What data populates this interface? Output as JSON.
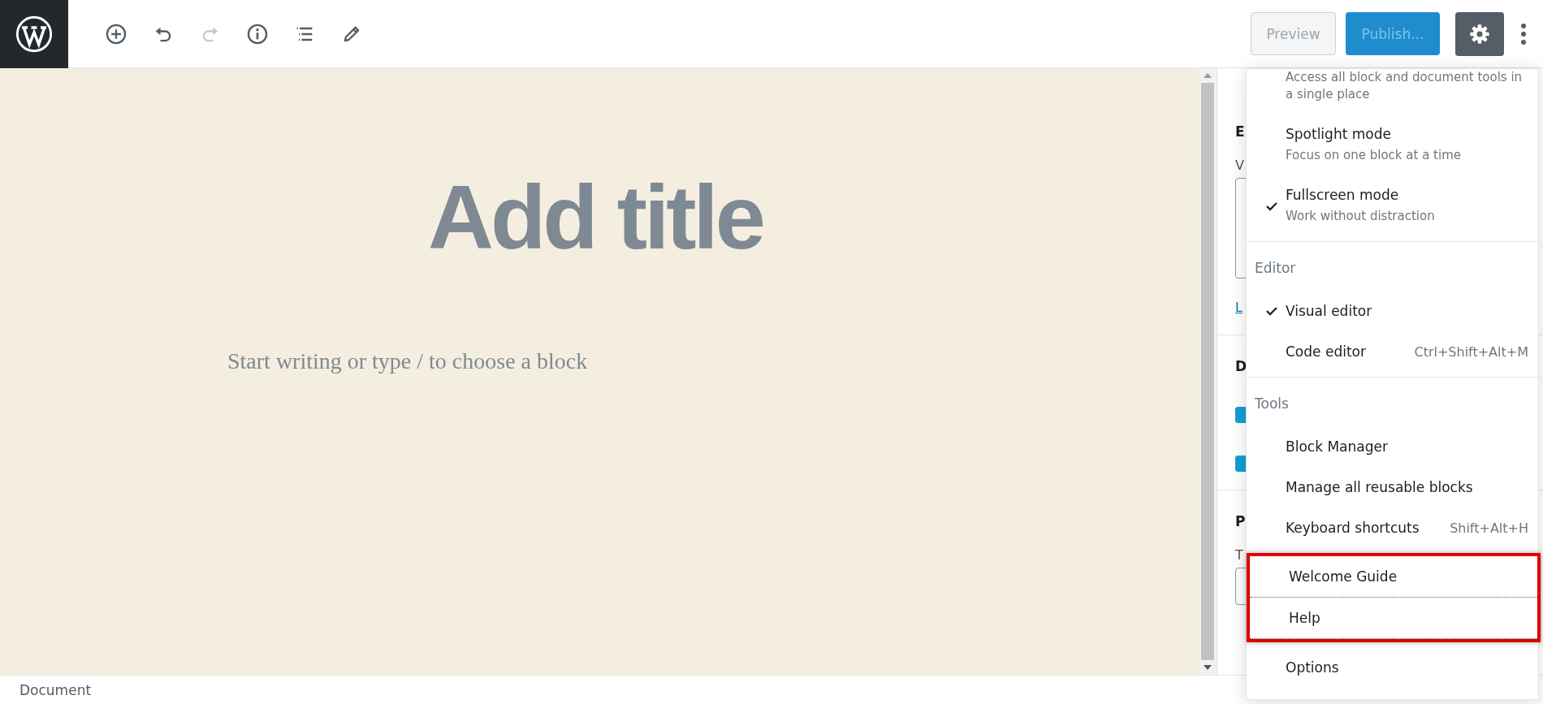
{
  "toolbar": {
    "tools": [
      {
        "kind": "add",
        "disabled": false
      },
      {
        "kind": "undo",
        "disabled": false
      },
      {
        "kind": "redo",
        "disabled": true
      },
      {
        "kind": "info",
        "disabled": false
      },
      {
        "kind": "outline",
        "disabled": false
      },
      {
        "kind": "edit",
        "disabled": false
      }
    ],
    "preview": {
      "label": "Preview"
    },
    "publish": {
      "label": "Publish...",
      "disabled": true
    },
    "settings": {
      "pressed": true
    }
  },
  "editor": {
    "title_placeholder": "Add title",
    "body_placeholder": "Start writing or type / to choose a block"
  },
  "sidebar": {
    "items": [
      {
        "kind": "heading",
        "text": "E"
      },
      {
        "kind": "label",
        "text": "V"
      },
      {
        "kind": "textarea"
      },
      {
        "kind": "link",
        "text": "L"
      },
      {
        "kind": "divider"
      },
      {
        "kind": "heading",
        "text": "D"
      },
      {
        "kind": "checkbox",
        "checked": true
      },
      {
        "kind": "checkbox",
        "checked": true
      },
      {
        "kind": "divider"
      },
      {
        "kind": "heading",
        "text": "P"
      },
      {
        "kind": "label",
        "text": "T"
      },
      {
        "kind": "input"
      }
    ]
  },
  "more_menu": {
    "sections": [
      {
        "framed": false,
        "items": [
          {
            "description": "Access all block and document tools in a single place",
            "checked": false
          },
          {
            "label": "Spotlight mode",
            "description": "Focus on one block at a time",
            "checked": false
          },
          {
            "label": "Fullscreen mode",
            "description": "Work without distraction",
            "checked": true
          }
        ]
      },
      {
        "heading": "Editor",
        "framed": false,
        "items": [
          {
            "label": "Visual editor",
            "checked": true
          },
          {
            "label": "Code editor",
            "shortcut": "Ctrl+Shift+Alt+M",
            "checked": false
          }
        ]
      },
      {
        "heading": "Tools",
        "framed": false,
        "items": [
          {
            "label": "Block Manager",
            "checked": false
          },
          {
            "label": "Manage all reusable blocks",
            "checked": false
          },
          {
            "label": "Keyboard shortcuts",
            "shortcut": "Shift+Alt+H",
            "checked": false
          }
        ]
      },
      {
        "framed": true,
        "items": [
          {
            "label": "Welcome Guide",
            "checked": false
          },
          {
            "label": "Help",
            "checked": false
          }
        ]
      },
      {
        "framed": false,
        "items": [
          {
            "label": "Options",
            "checked": false
          }
        ]
      }
    ]
  },
  "status_bar": {
    "breadcrumb": "Document"
  }
}
